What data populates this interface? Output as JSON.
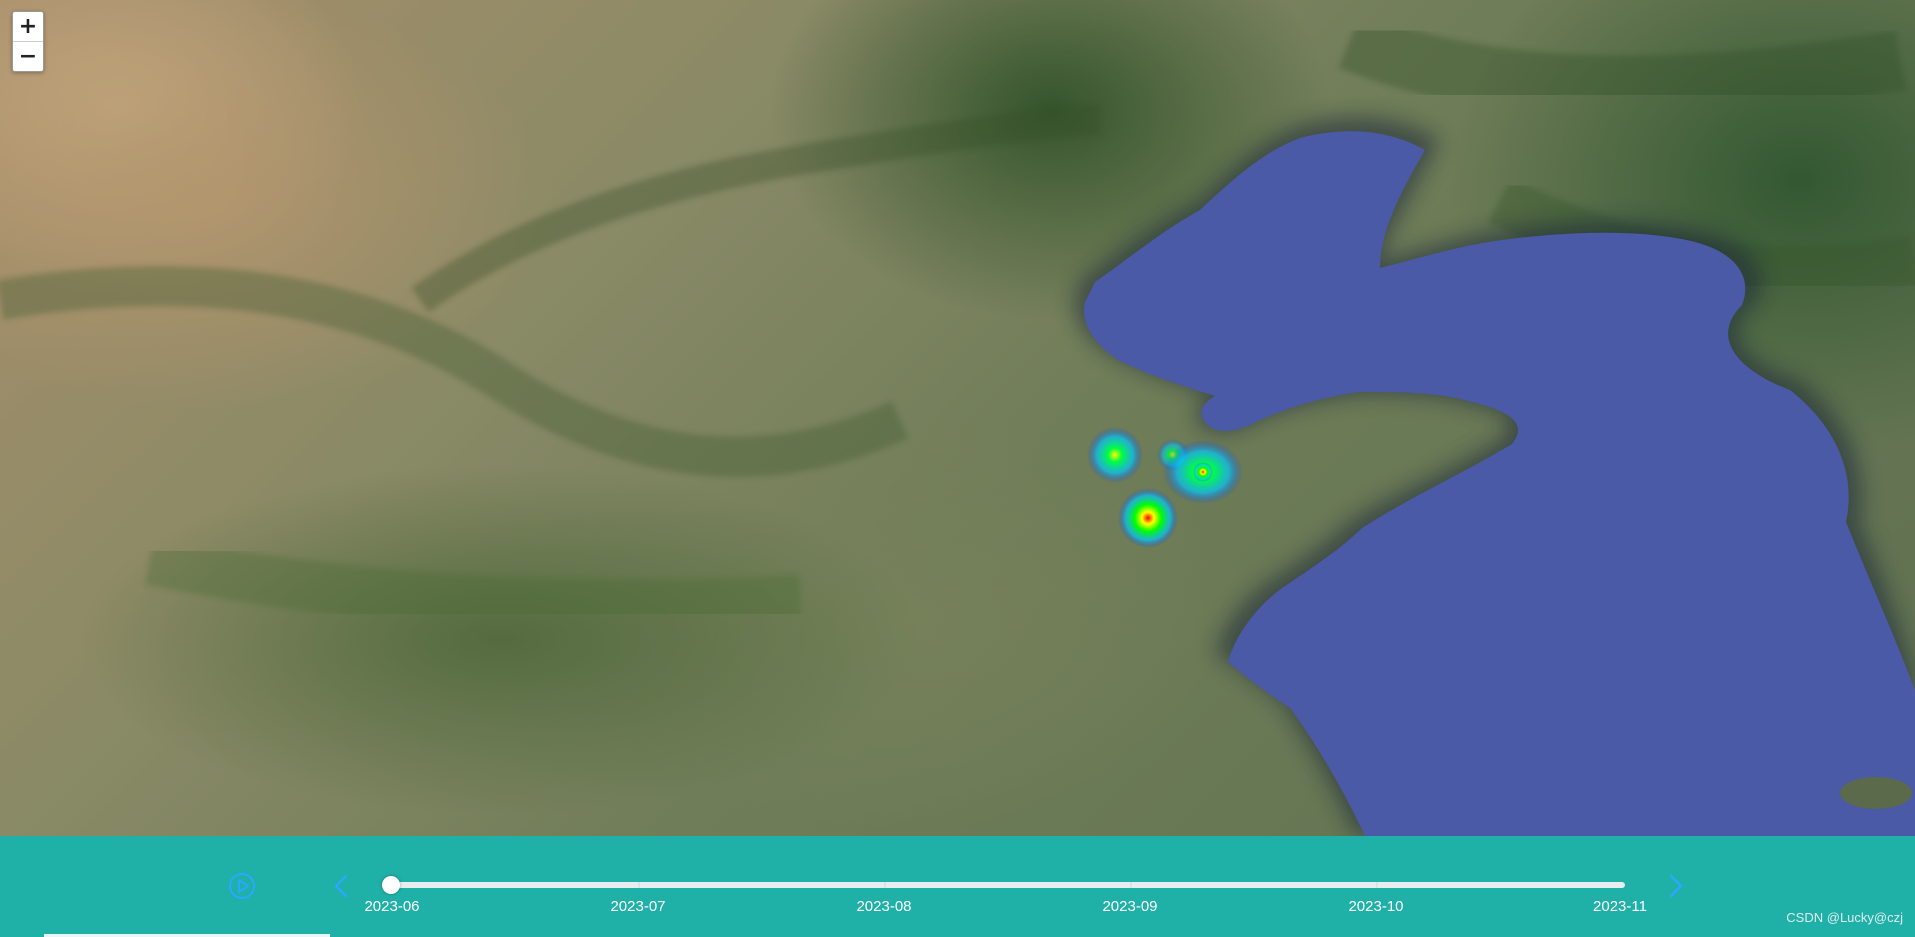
{
  "map": {
    "zoom_in_label": "+",
    "zoom_out_label": "−",
    "heatmap_colors": [
      "#0000ff",
      "#00ffff",
      "#00ff00",
      "#ffff00",
      "#ff0000"
    ],
    "sea_color": "#4a5aa6"
  },
  "timeline": {
    "background_color": "#1fb0a8",
    "accent_color": "#2aa8ff",
    "play_icon": "play-circle-icon",
    "prev_icon": "chevron-left-icon",
    "next_icon": "chevron-right-icon",
    "labels": [
      "2023-06",
      "2023-07",
      "2023-08",
      "2023-09",
      "2023-10",
      "2023-11"
    ],
    "current_index": 0
  },
  "watermark": "CSDN @Lucky@czj"
}
